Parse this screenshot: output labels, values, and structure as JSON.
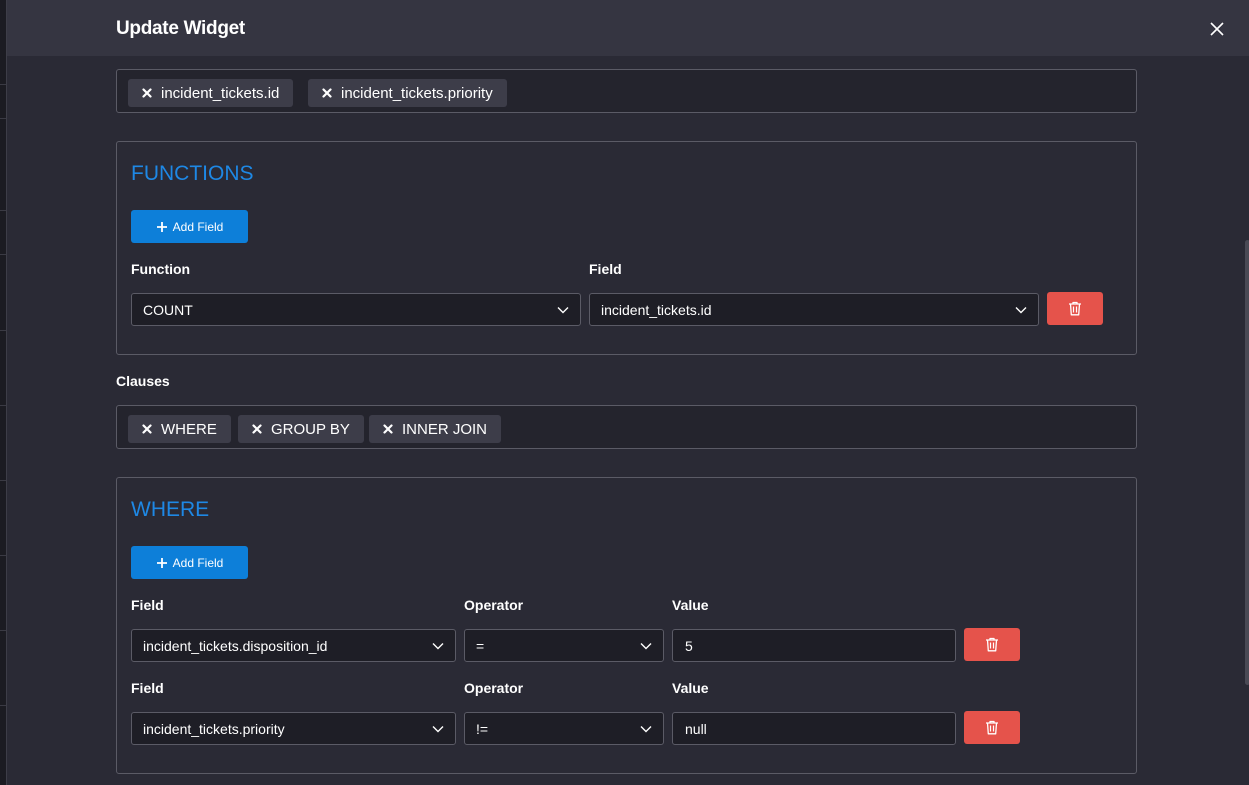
{
  "modal": {
    "title": "Update Widget"
  },
  "selected_columns": [
    {
      "label": "incident_tickets.id"
    },
    {
      "label": "incident_tickets.priority"
    }
  ],
  "functions": {
    "title": "FUNCTIONS",
    "add_label": "Add Field",
    "function_label": "Function",
    "field_label": "Field",
    "rows": [
      {
        "function": "COUNT",
        "field": "incident_tickets.id"
      }
    ]
  },
  "clauses": {
    "label": "Clauses",
    "tags": [
      {
        "label": "WHERE"
      },
      {
        "label": "GROUP BY"
      },
      {
        "label": "INNER JOIN"
      }
    ]
  },
  "where": {
    "title": "WHERE",
    "add_label": "Add Field",
    "rows": [
      {
        "field_label": "Field",
        "operator_label": "Operator",
        "value_label": "Value",
        "field": "incident_tickets.disposition_id",
        "operator": "=",
        "value": "5"
      },
      {
        "field_label": "Field",
        "operator_label": "Operator",
        "value_label": "Value",
        "field": "incident_tickets.priority",
        "operator": "!=",
        "value": "null"
      }
    ]
  },
  "colors": {
    "accent": "#1e88e5",
    "primary_button": "#0d7fd9",
    "danger_button": "#e5534b",
    "modal_bg": "#2a2a35",
    "header_bg": "#353541"
  }
}
